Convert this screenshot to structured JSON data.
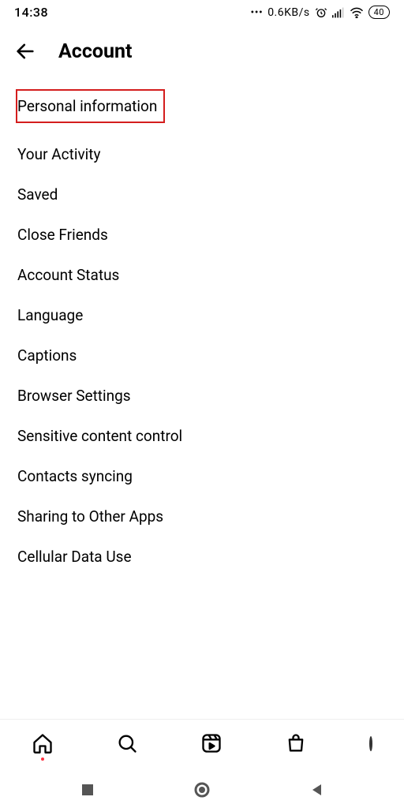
{
  "status": {
    "time": "14:38",
    "net_speed": "0.6KB/s",
    "battery": "40"
  },
  "header": {
    "title": "Account"
  },
  "menu": {
    "items": [
      "Personal information",
      "Your Activity",
      "Saved",
      "Close Friends",
      "Account Status",
      "Language",
      "Captions",
      "Browser Settings",
      "Sensitive content control",
      "Contacts syncing",
      "Sharing to Other Apps",
      "Cellular Data Use"
    ]
  }
}
